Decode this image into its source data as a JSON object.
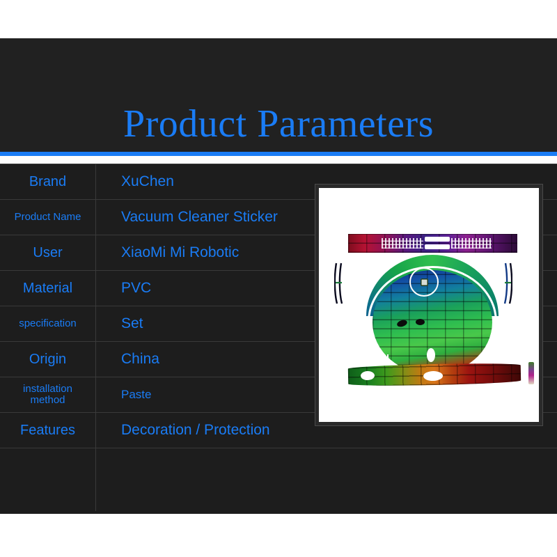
{
  "header": {
    "title": "Product Parameters",
    "accent_color": "#1a7cf5",
    "background_color": "#212121"
  },
  "spec_table": {
    "rows": [
      {
        "label": "Brand",
        "value": "XuChen"
      },
      {
        "label": "Product Name",
        "value": "Vacuum Cleaner Sticker"
      },
      {
        "label": "User",
        "value": "XiaoMi Mi Robotic"
      },
      {
        "label": "Material",
        "value": "PVC"
      },
      {
        "label": "specification",
        "value": "Set"
      },
      {
        "label": "Origin",
        "value": "China"
      },
      {
        "label": "installation\nmethod",
        "value": "Paste"
      },
      {
        "label": "Features",
        "value": "Decoration / Protection"
      },
      {
        "label": "",
        "value": ""
      }
    ]
  },
  "product_image": {
    "caption": "Robot vacuum sticker skin set — graffiti brick wall print",
    "pieces": [
      "top-control-strip",
      "circular-lid-sticker",
      "left-side-strip",
      "right-side-strip",
      "bottom-bumper-strip",
      "corner-trim-piece"
    ],
    "background_color": "#ffffff",
    "frame_color": "#2a2a2a"
  }
}
